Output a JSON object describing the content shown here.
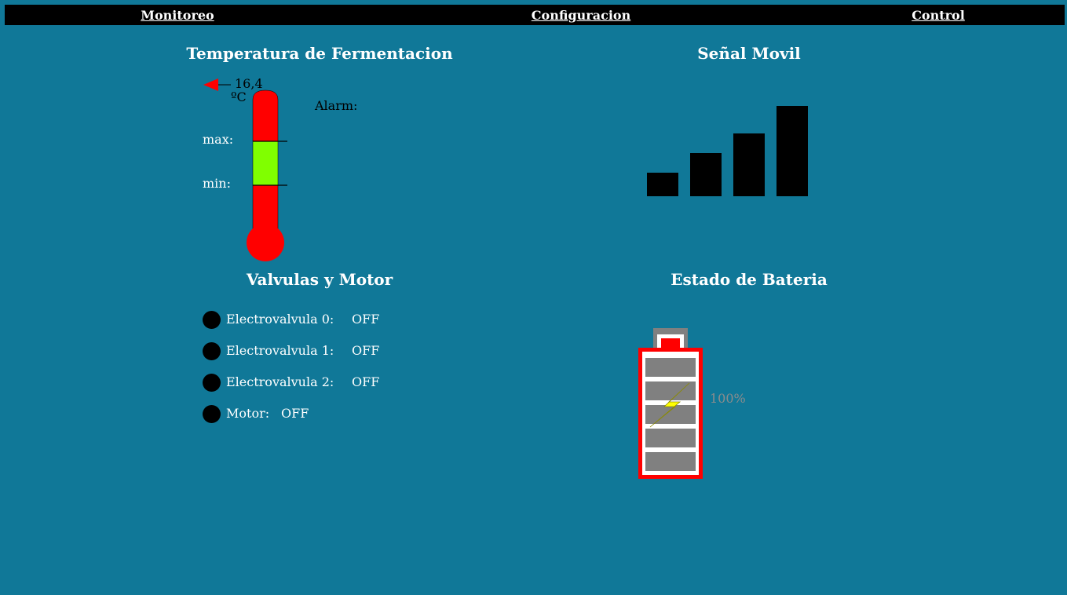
{
  "nav": {
    "monitoreo": "Monitoreo",
    "configuracion": "Configuracion",
    "control": "Control"
  },
  "temperature": {
    "title": "Temperatura de Fermentacion",
    "value": "16,4",
    "unit": "ºC",
    "alarm_label": "Alarm:",
    "max_label": "max:",
    "min_label": "min:"
  },
  "signal": {
    "title": "Señal Movil",
    "bars_active": 4,
    "bars_total": 4
  },
  "valves": {
    "title": "Valvulas y Motor",
    "items": [
      {
        "name": "Electrovalvula 0:",
        "state": "OFF"
      },
      {
        "name": "Electrovalvula 1:",
        "state": "OFF"
      },
      {
        "name": "Electrovalvula 2:",
        "state": "OFF"
      },
      {
        "name": "Motor:",
        "state": "OFF"
      }
    ]
  },
  "battery": {
    "title": "Estado de Bateria",
    "percent": "100%",
    "charging": true
  },
  "colors": {
    "background": "#107898",
    "thermo_red": "#ff0000",
    "thermo_green": "#80ff00",
    "battery_frame": "#ff0000",
    "battery_cell": "#808080",
    "bolt": "#ffff00",
    "led_off": "#000000"
  },
  "icons": [
    "temperature-pointer-icon",
    "thermometer-icon",
    "signal-bars-icon",
    "battery-icon",
    "lightning-bolt-icon",
    "status-led-icon"
  ]
}
